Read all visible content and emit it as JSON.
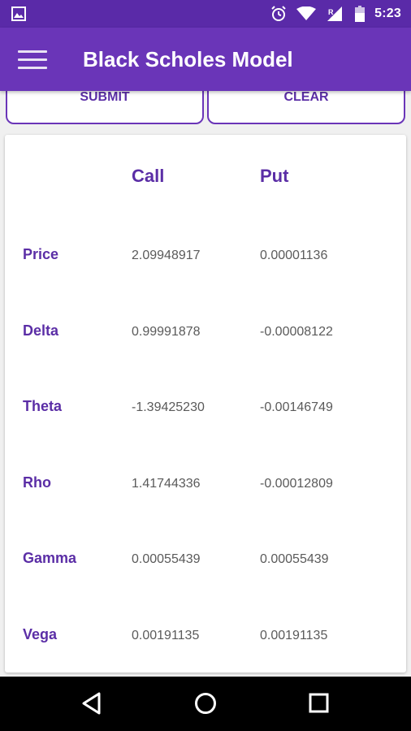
{
  "status_bar": {
    "time": "5:23",
    "icons": [
      "image-icon",
      "alarm-icon",
      "wifi-icon",
      "signal-icon",
      "battery-icon"
    ]
  },
  "app_bar": {
    "title": "Black Scholes Model",
    "menu_icon": "hamburger-menu-icon"
  },
  "buttons": {
    "submit": "SUBMIT",
    "clear": "CLEAR"
  },
  "results": {
    "columns": {
      "call": "Call",
      "put": "Put"
    },
    "rows": [
      {
        "label": "Price",
        "call": "2.09948917",
        "put": "0.00001136"
      },
      {
        "label": "Delta",
        "call": "0.99991878",
        "put": "-0.00008122"
      },
      {
        "label": "Theta",
        "call": "-1.39425230",
        "put": "-0.00146749"
      },
      {
        "label": "Rho",
        "call": "1.41744336",
        "put": "-0.00012809"
      },
      {
        "label": "Gamma",
        "call": "0.00055439",
        "put": "0.00055439"
      },
      {
        "label": "Vega",
        "call": "0.00191135",
        "put": "0.00191135"
      }
    ]
  },
  "nav_bar": {
    "icons": [
      "back-icon",
      "home-icon",
      "recents-icon"
    ]
  },
  "colors": {
    "primary": "#6a35b8",
    "primary_dark": "#5a2aa8",
    "accent_text": "#5b2ea6",
    "value_text": "#5a5a5a"
  }
}
